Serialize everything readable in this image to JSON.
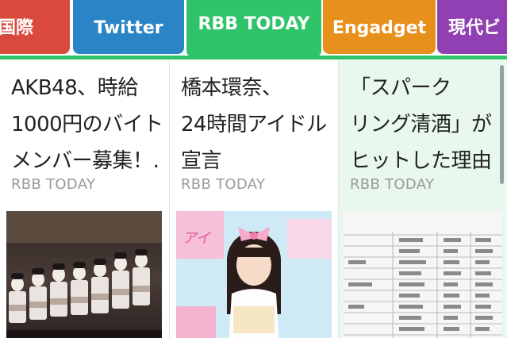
{
  "tabs": [
    {
      "label": "国際",
      "color": "#d94a3d"
    },
    {
      "label": "Twitter",
      "color": "#2b84c6"
    },
    {
      "label": "RBB TODAY",
      "color": "#2fc46a",
      "selected": true
    },
    {
      "label": "Engadget",
      "color": "#e8901c"
    },
    {
      "label": "現代ビ",
      "color": "#9140b3"
    }
  ],
  "articles": [
    {
      "title_lines": [
        "AKB48、時給",
        "1000円のバイト",
        "メンバー募集！…"
      ],
      "source": "RBB TODAY",
      "thumbnail": "group-stage-photo"
    },
    {
      "title_lines": [
        "橋本環奈、",
        "24時間アイドル",
        "宣言"
      ],
      "source": "RBB TODAY",
      "thumbnail": "idol-portrait-photo"
    },
    {
      "title_lines": [
        "「スパーク",
        "リング清酒」が",
        "ヒットした理由"
      ],
      "source": "RBB TODAY",
      "thumbnail": "document-table-image"
    }
  ],
  "colors": {
    "accent": "#2fc46a",
    "selected_card_bg": "#e9f8ee",
    "source_text": "#9a9a9a"
  }
}
